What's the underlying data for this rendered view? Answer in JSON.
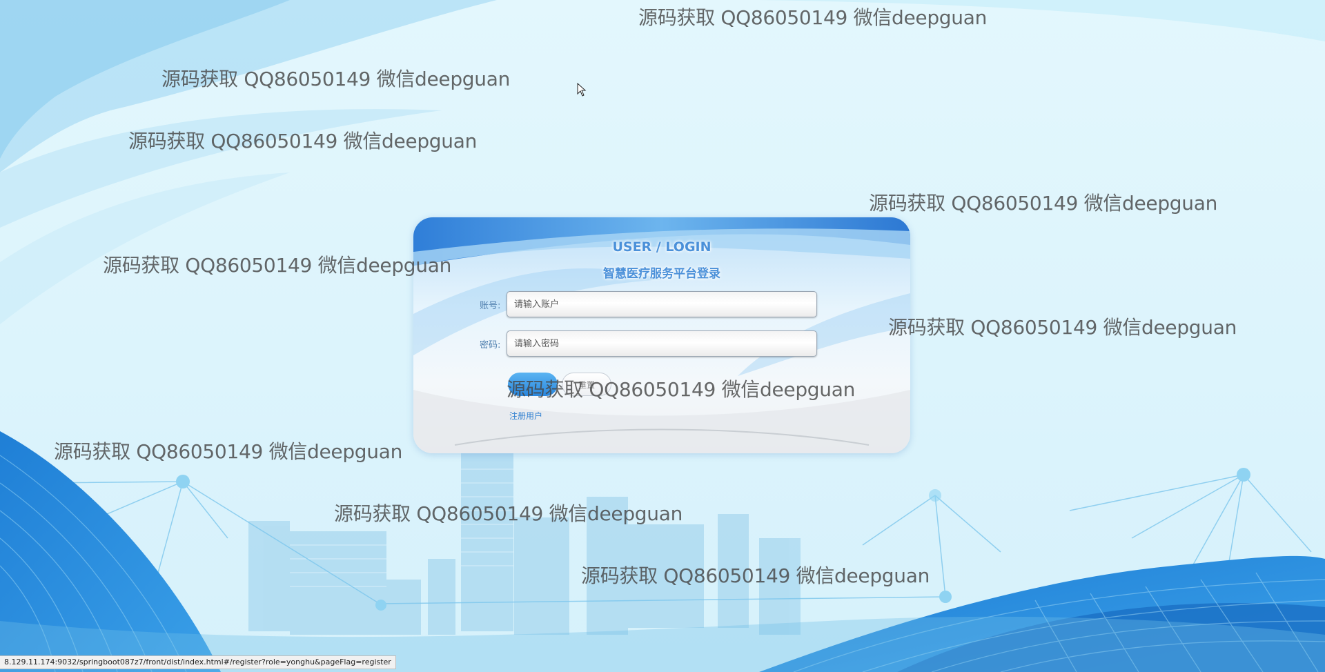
{
  "login": {
    "title_en": "USER / LOGIN",
    "title_cn": "智慧医疗服务平台登录",
    "account_label": "账号:",
    "account_placeholder": "请输入账户",
    "password_label": "密码:",
    "password_placeholder": "请输入密码",
    "login_button": "",
    "reset_button": "重置",
    "register_link": "注册用户"
  },
  "watermark_text": "源码获取 QQ86050149 微信deepguan",
  "status_bar": {
    "url": "8.129.11.174:9032/springboot087z7/front/dist/index.html#/register?role=yonghu&pageFlag=register"
  },
  "colors": {
    "accent": "#2a86dd",
    "title": "#4a90d9",
    "link": "#2f7fd0"
  },
  "icons": [
    "mouse-cursor-icon"
  ]
}
